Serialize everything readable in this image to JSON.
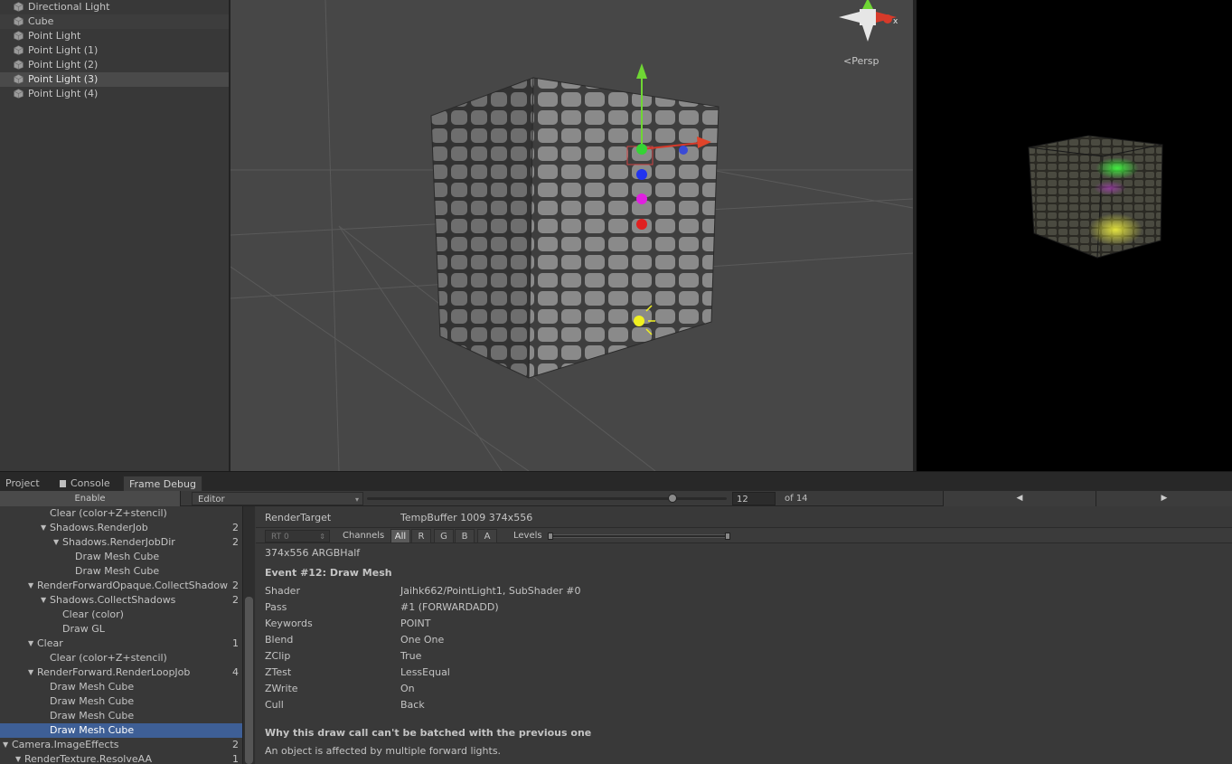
{
  "hierarchy": {
    "items": [
      {
        "label": "Directional Light"
      },
      {
        "label": "Cube"
      },
      {
        "label": "Point Light"
      },
      {
        "label": "Point Light (1)"
      },
      {
        "label": "Point Light (2)"
      },
      {
        "label": "Point Light (3)"
      },
      {
        "label": "Point Light (4)"
      }
    ]
  },
  "scene": {
    "projection_label": "<Persp",
    "colors": {
      "background": "#474747",
      "grid": "#5a5a5a"
    }
  },
  "tabs": [
    {
      "label": "Project",
      "icon": "folder-icon"
    },
    {
      "label": "Console",
      "icon": "console-icon"
    },
    {
      "label": "Frame Debug",
      "icon": "frame-debug-icon",
      "active": true
    }
  ],
  "toolbar": {
    "enable_label": "Enable",
    "target_select": "Editor",
    "event_value": "12",
    "event_total_label": "of 14",
    "slider_progress": 0.85
  },
  "event_tree": [
    {
      "label": "Clear (color+Z+stencil)",
      "level": 3,
      "expanded": null,
      "count": ""
    },
    {
      "label": "Shadows.RenderJob",
      "level": 3,
      "expanded": true,
      "count": "2"
    },
    {
      "label": "Shadows.RenderJobDir",
      "level": 4,
      "expanded": true,
      "count": "2"
    },
    {
      "label": "Draw Mesh Cube",
      "level": 5,
      "expanded": null,
      "count": ""
    },
    {
      "label": "Draw Mesh Cube",
      "level": 5,
      "expanded": null,
      "count": ""
    },
    {
      "label": "RenderForwardOpaque.CollectShadows",
      "level": 2,
      "expanded": true,
      "count": "2"
    },
    {
      "label": "Shadows.CollectShadows",
      "level": 3,
      "expanded": true,
      "count": "2"
    },
    {
      "label": "Clear (color)",
      "level": 4,
      "expanded": null,
      "count": ""
    },
    {
      "label": "Draw GL",
      "level": 4,
      "expanded": null,
      "count": ""
    },
    {
      "label": "Clear",
      "level": 2,
      "expanded": true,
      "count": "1"
    },
    {
      "label": "Clear (color+Z+stencil)",
      "level": 3,
      "expanded": null,
      "count": ""
    },
    {
      "label": "RenderForward.RenderLoopJob",
      "level": 2,
      "expanded": true,
      "count": "4"
    },
    {
      "label": "Draw Mesh Cube",
      "level": 3,
      "expanded": null,
      "count": ""
    },
    {
      "label": "Draw Mesh Cube",
      "level": 3,
      "expanded": null,
      "count": ""
    },
    {
      "label": "Draw Mesh Cube",
      "level": 3,
      "expanded": null,
      "count": ""
    },
    {
      "label": "Draw Mesh Cube",
      "level": 3,
      "expanded": null,
      "count": "",
      "selected": true
    },
    {
      "label": "Camera.ImageEffects",
      "level": 0,
      "expanded": true,
      "count": "2"
    },
    {
      "label": "RenderTexture.ResolveAA",
      "level": 1,
      "expanded": true,
      "count": "1"
    }
  ],
  "details": {
    "render_target_label": "RenderTarget",
    "render_target_value": "TempBuffer 1009 374x556",
    "rt_select": "RT 0",
    "channels_label": "Channels",
    "channels": [
      "All",
      "R",
      "G",
      "B",
      "A"
    ],
    "active_channel": "All",
    "levels_label": "Levels",
    "format": "374x556 ARGBHalf",
    "event_title": "Event #12: Draw Mesh",
    "props": [
      {
        "label": "Shader",
        "value": "Jaihk662/PointLight1, SubShader #0"
      },
      {
        "label": "Pass",
        "value": "#1 (FORWARDADD)"
      },
      {
        "label": "Keywords",
        "value": "POINT"
      },
      {
        "label": "Blend",
        "value": "One One"
      },
      {
        "label": "ZClip",
        "value": "True"
      },
      {
        "label": "ZTest",
        "value": "LessEqual"
      },
      {
        "label": "ZWrite",
        "value": "On"
      },
      {
        "label": "Cull",
        "value": "Back"
      }
    ],
    "batch_title": "Why this draw call can't be batched with the previous one",
    "batch_reason": "An object is affected by multiple forward lights."
  },
  "colors": {
    "selection": "#3e5f96",
    "panel": "#383838",
    "light_green": "#35d435",
    "light_blue": "#2233ee",
    "light_magenta": "#e020e0",
    "light_red": "#e02020",
    "light_yellow": "#f0f020"
  }
}
